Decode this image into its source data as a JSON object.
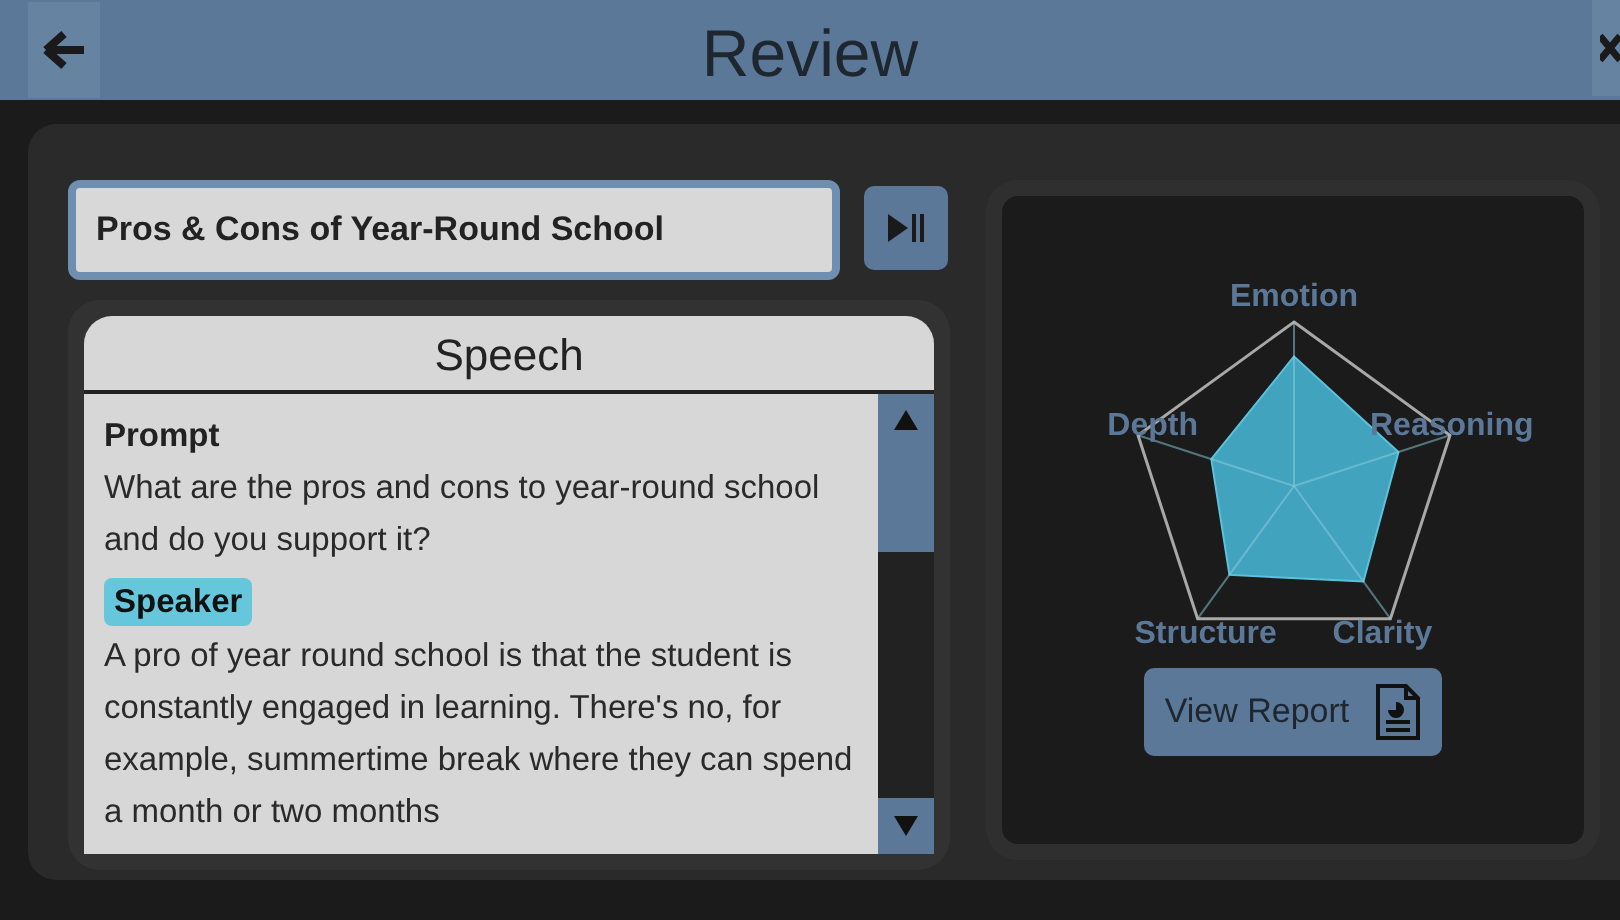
{
  "header": {
    "title": "Review"
  },
  "topic": {
    "value": "Pros & Cons of Year-Round School"
  },
  "speech": {
    "title": "Speech",
    "prompt_label": "Prompt",
    "prompt": "What are the pros and cons to year-round school and do you support it?",
    "speaker_label": "Speaker",
    "transcript": "A pro of year round school is that the student is constantly engaged in learning. There's no, for example, summertime break where they can spend a month or two months"
  },
  "radar": {
    "axes": [
      "Emotion",
      "Reasoning",
      "Clarity",
      "Structure",
      "Depth"
    ]
  },
  "view_report": {
    "label": "View Report"
  }
}
